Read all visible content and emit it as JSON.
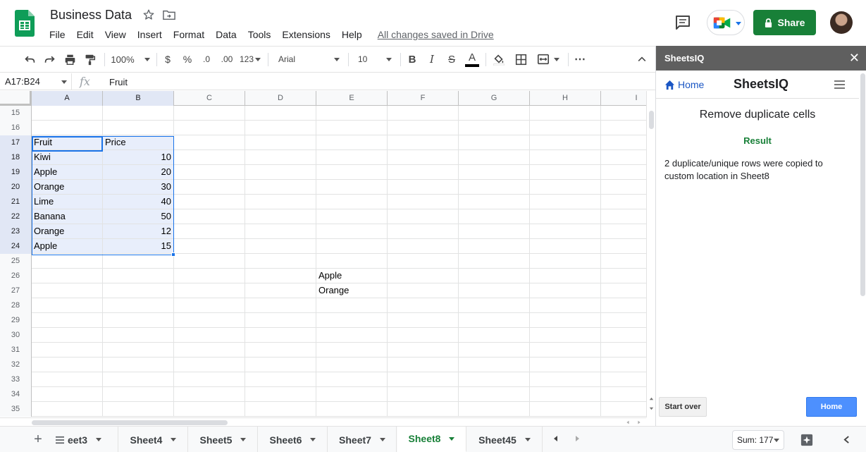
{
  "app": {
    "doc_title": "Business Data",
    "menu": [
      "File",
      "Edit",
      "View",
      "Insert",
      "Format",
      "Data",
      "Tools",
      "Extensions",
      "Help"
    ],
    "saved_status": "All changes saved in Drive",
    "share_label": "Share"
  },
  "toolbar": {
    "zoom": "100%",
    "currency": "$",
    "percent": "%",
    "decrease_decimal": ".0",
    "increase_decimal": ".00",
    "number_format": "123",
    "font": "Arial",
    "font_size": "10",
    "bold": "B",
    "italic": "I",
    "strikethrough": "S",
    "text_color": "A",
    "more": "⋯"
  },
  "formula_bar": {
    "name_box": "A17:B24",
    "fx": "fx",
    "value": "Fruit"
  },
  "grid": {
    "columns": [
      "A",
      "B",
      "C",
      "D",
      "E",
      "F",
      "G",
      "H",
      "I"
    ],
    "rows": [
      {
        "num": "15",
        "cells": [
          "",
          "",
          "",
          "",
          ""
        ]
      },
      {
        "num": "16",
        "cells": [
          "",
          "",
          "",
          "",
          ""
        ]
      },
      {
        "num": "17",
        "cells": [
          "Fruit",
          "Price",
          "",
          "",
          ""
        ]
      },
      {
        "num": "18",
        "cells": [
          "Kiwi",
          "10",
          "",
          "",
          ""
        ]
      },
      {
        "num": "19",
        "cells": [
          "Apple",
          "20",
          "",
          "",
          ""
        ]
      },
      {
        "num": "20",
        "cells": [
          "Orange",
          "30",
          "",
          "",
          ""
        ]
      },
      {
        "num": "21",
        "cells": [
          "Lime",
          "40",
          "",
          "",
          ""
        ]
      },
      {
        "num": "22",
        "cells": [
          "Banana",
          "50",
          "",
          "",
          ""
        ]
      },
      {
        "num": "23",
        "cells": [
          "Orange",
          "12",
          "",
          "",
          ""
        ]
      },
      {
        "num": "24",
        "cells": [
          "Apple",
          "15",
          "",
          "",
          ""
        ]
      },
      {
        "num": "25",
        "cells": [
          "",
          "",
          "",
          "",
          ""
        ]
      },
      {
        "num": "26",
        "cells": [
          "",
          "",
          "",
          "",
          "Apple"
        ]
      },
      {
        "num": "27",
        "cells": [
          "",
          "",
          "",
          "",
          "Orange"
        ]
      },
      {
        "num": "28",
        "cells": [
          "",
          "",
          "",
          "",
          ""
        ]
      },
      {
        "num": "29",
        "cells": [
          "",
          "",
          "",
          "",
          ""
        ]
      },
      {
        "num": "30",
        "cells": [
          "",
          "",
          "",
          "",
          ""
        ]
      },
      {
        "num": "31",
        "cells": [
          "",
          "",
          "",
          "",
          ""
        ]
      },
      {
        "num": "32",
        "cells": [
          "",
          "",
          "",
          "",
          ""
        ]
      },
      {
        "num": "33",
        "cells": [
          "",
          "",
          "",
          "",
          ""
        ]
      },
      {
        "num": "34",
        "cells": [
          "",
          "",
          "",
          "",
          ""
        ]
      },
      {
        "num": "35",
        "cells": [
          "",
          "",
          "",
          "",
          ""
        ]
      }
    ]
  },
  "sheets": {
    "tabs": [
      "eet3",
      "Sheet4",
      "Sheet5",
      "Sheet6",
      "Sheet7",
      "Sheet8",
      "Sheet45"
    ],
    "active": "Sheet8",
    "sum": "Sum: 177"
  },
  "panel": {
    "header": "SheetsIQ",
    "close": "✕",
    "home_link": "Home",
    "title": "SheetsIQ",
    "heading": "Remove duplicate cells",
    "result_label": "Result",
    "result_text": "2 duplicate/unique rows were copied to custom location in Sheet8",
    "start_over": "Start over",
    "home_button": "Home"
  },
  "colors": {
    "accent": "#188038",
    "selection": "#1a73e8",
    "panel_header": "#5f5f5f",
    "home_button": "#4d90fe"
  }
}
